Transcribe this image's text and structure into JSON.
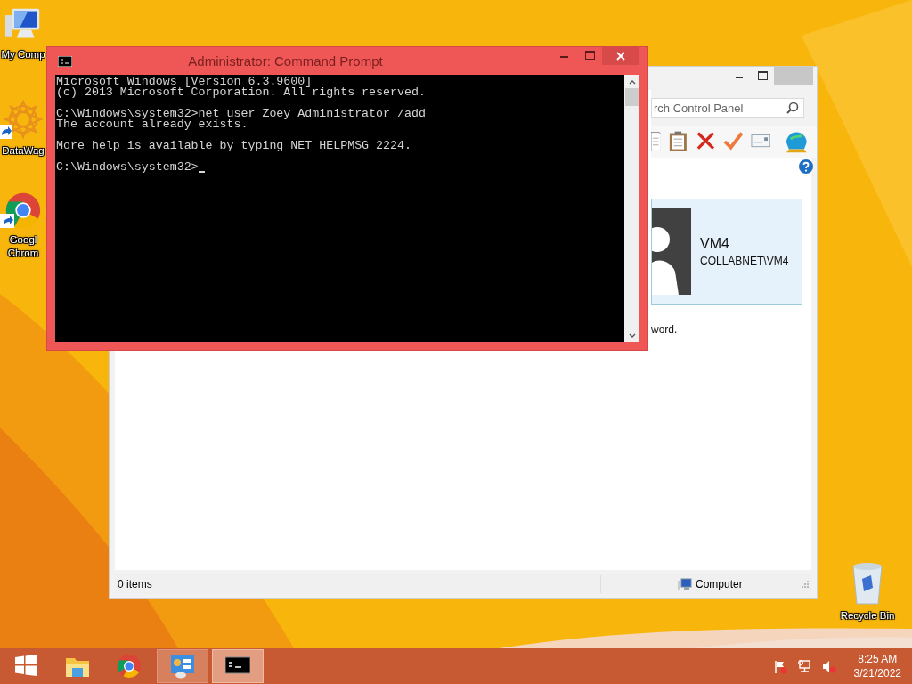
{
  "desktop_icons": [
    {
      "kind": "computer",
      "shortcut": false,
      "label_lines": [
        "My Comp"
      ]
    },
    {
      "kind": "mandala",
      "shortcut": true,
      "label_lines": [
        "DataWag"
      ]
    },
    {
      "kind": "chrome",
      "shortcut": true,
      "label_lines": [
        "Googl",
        "Chrom"
      ]
    },
    {
      "kind": "recycle",
      "shortcut": false,
      "label_lines": [
        "Recycle Bin"
      ]
    }
  ],
  "control_panel": {
    "search": {
      "placeholder": "rch Control Panel"
    },
    "toolbar": [
      {
        "kind": "document"
      },
      {
        "kind": "clipboard"
      },
      {
        "kind": "delete"
      },
      {
        "kind": "check"
      },
      {
        "kind": "card"
      },
      {
        "kind": "separator"
      },
      {
        "kind": "globe"
      }
    ],
    "user": {
      "name": "VM4",
      "account": "COLLABNET\\VM4"
    },
    "text_fragment": "word.",
    "status_bar": {
      "items": "0 items",
      "location": "Computer"
    }
  },
  "command_prompt": {
    "title": "Administrator: Command Prompt",
    "blocks": [
      [
        "Microsoft Windows [Version 6.3.9600]",
        "(c) 2013 Microsoft Corporation. All rights reserved."
      ],
      [
        "C:\\Windows\\system32>net user Zoey Administrator /add",
        "The account already exists."
      ],
      [
        "More help is available by typing NET HELPMSG 2224."
      ]
    ],
    "prompt": {
      "text": "C:\\Windows\\system32>",
      "cursor": true
    }
  },
  "taskbar": {
    "items": [
      {
        "kind": "start",
        "running": false,
        "selected": false
      },
      {
        "kind": "explorer",
        "running": false,
        "selected": false
      },
      {
        "kind": "chrome",
        "running": false,
        "selected": false
      },
      {
        "kind": "control-panel",
        "running": true,
        "selected": false
      },
      {
        "kind": "console",
        "running": true,
        "selected": true
      }
    ],
    "tray_icons": [
      {
        "kind": "flag"
      },
      {
        "kind": "network"
      },
      {
        "kind": "speaker-muted"
      }
    ],
    "time": "8:25 AM",
    "date": "3/21/2022"
  }
}
